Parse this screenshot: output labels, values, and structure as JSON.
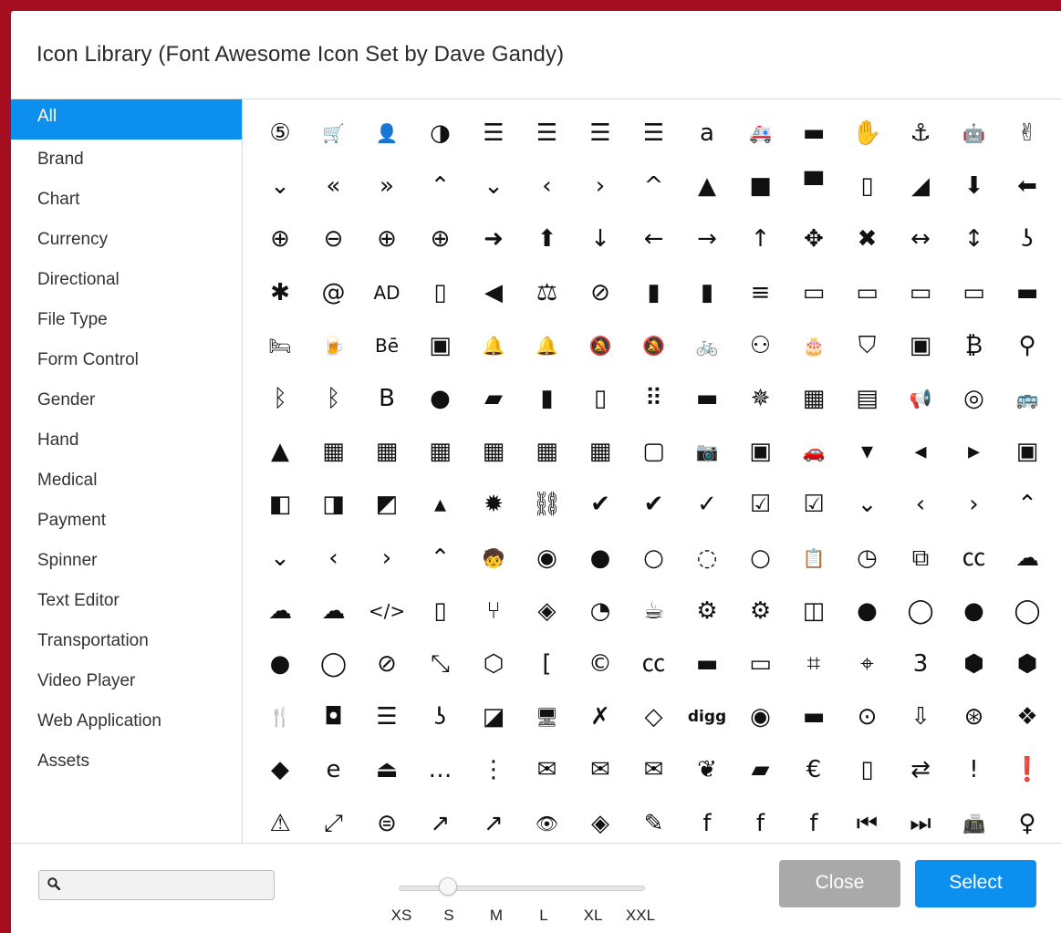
{
  "dialog": {
    "title": "Icon Library (Font Awesome Icon Set by Dave Gandy)"
  },
  "categories": [
    {
      "label": "All",
      "active": true
    },
    {
      "label": "Brand"
    },
    {
      "label": "Chart"
    },
    {
      "label": "Currency"
    },
    {
      "label": "Directional"
    },
    {
      "label": "File Type"
    },
    {
      "label": "Form Control"
    },
    {
      "label": "Gender"
    },
    {
      "label": "Hand"
    },
    {
      "label": "Medical"
    },
    {
      "label": "Payment"
    },
    {
      "label": "Spinner"
    },
    {
      "label": "Text Editor"
    },
    {
      "label": "Transportation"
    },
    {
      "label": "Video Player"
    },
    {
      "label": "Web Application"
    },
    {
      "label": "Assets"
    }
  ],
  "icons": [
    [
      "html5",
      "cart-arrow-down",
      "user-plus",
      "adjust",
      "align-center",
      "align-justify",
      "align-left",
      "align-right",
      "amazon",
      "ambulance",
      "amex",
      "asl-interpreting",
      "anchor",
      "android",
      "hand-peace"
    ],
    [
      "angle-double-down",
      "angle-double-left",
      "angle-double-right",
      "angle-double-up",
      "angle-down",
      "angle-left",
      "angle-right",
      "angle-up",
      "angellist",
      "apple",
      "archive",
      "file-zip",
      "area-chart",
      "arrow-circle-down",
      "arrow-circle-left"
    ],
    [
      "arrow-circle-o-down",
      "arrow-circle-o-left",
      "arrow-circle-o-right",
      "arrow-circle-o-up",
      "arrow-circle-right",
      "arrow-circle-up",
      "arrow-down",
      "arrow-left",
      "arrow-right",
      "arrow-up",
      "arrows",
      "arrows-alt",
      "arrows-h",
      "arrows-v",
      "assistive-listening"
    ],
    [
      "asterisk",
      "at",
      "audio-description",
      "file-audio",
      "backward",
      "balance-scale",
      "ban",
      "bar-chart",
      "barcode",
      "bars",
      "battery-3",
      "battery-1",
      "battery-2",
      "battery-empty",
      "battery-full"
    ],
    [
      "bed",
      "beer",
      "behance",
      "behance-square",
      "bell",
      "bell-o",
      "bell-slash",
      "bell-slash-o",
      "bicycle",
      "binoculars",
      "birthday-cake",
      "bitbucket",
      "bitbucket-square",
      "bitcoin",
      "blind"
    ],
    [
      "bluetooth",
      "bluetooth-b",
      "bold",
      "bomb",
      "book",
      "bookmark",
      "bookmark-o",
      "braille",
      "briefcase",
      "bug",
      "building",
      "building-o",
      "bullhorn",
      "bullseye",
      "bus"
    ],
    [
      "buysellads",
      "calculator",
      "calendar",
      "calendar-check",
      "calendar-minus",
      "calendar-plus",
      "calendar-times",
      "calendar-o",
      "camera",
      "camera-retro",
      "car",
      "caret-down",
      "caret-left",
      "caret-right",
      "caret-square-down"
    ],
    [
      "caret-square-left",
      "caret-square-right",
      "caret-square-up",
      "caret-up",
      "certificate",
      "chain-broken",
      "check",
      "check-circle",
      "check-circle-o",
      "check-square",
      "check-square-o",
      "chevron-circle-down",
      "chevron-circle-left",
      "chevron-circle-right",
      "chevron-circle-up"
    ],
    [
      "chevron-down",
      "chevron-left",
      "chevron-right",
      "chevron-up",
      "child",
      "chrome",
      "circle",
      "circle-o",
      "circle-o-notch",
      "circle-thin",
      "clipboard",
      "clock",
      "clone",
      "closed-captioning",
      "cloud"
    ],
    [
      "cloud-download",
      "cloud-upload",
      "code",
      "file-code",
      "code-fork",
      "codepen",
      "codiepie",
      "coffee",
      "cog",
      "cogs",
      "columns",
      "comment",
      "comment-o",
      "commenting",
      "commenting-o"
    ],
    [
      "comments",
      "comments-o",
      "compass",
      "compress",
      "connectdevelop",
      "contao",
      "copyright",
      "creative-commons",
      "credit-card",
      "credit-card-alt",
      "crop",
      "crosshairs",
      "css3",
      "cube",
      "cubes"
    ],
    [
      "cutlery",
      "dashcube",
      "database",
      "deaf",
      "delicious",
      "desktop",
      "deviantart",
      "diamond",
      "digg",
      "cc-diners-club",
      "cc-discover",
      "dot-circle",
      "download",
      "dribbble",
      "dropbox"
    ],
    [
      "drupal",
      "edge",
      "eject",
      "ellipsis-h",
      "ellipsis-v",
      "envelope",
      "envelope-o",
      "envelope-square",
      "envira",
      "eraser",
      "euro",
      "file-excel",
      "exchange",
      "exclamation",
      "exclamation-circle"
    ],
    [
      "exclamation-triangle",
      "expand",
      "expeditedssl",
      "external-link",
      "external-link-square",
      "eye",
      "eye-slash",
      "eyedropper",
      "facebook",
      "facebook-square",
      "facebook-official",
      "fast-backward",
      "fast-forward",
      "fax",
      "female"
    ]
  ],
  "search": {
    "value": "",
    "placeholder": ""
  },
  "size_slider": {
    "labels": [
      "XS",
      "S",
      "M",
      "L",
      "XL",
      "XXL"
    ],
    "selected": "S"
  },
  "buttons": {
    "close_label": "Close",
    "select_label": "Select"
  },
  "colors": {
    "accent": "#0d8ff0",
    "close": "#a9a9a9",
    "frame": "#a50e1f"
  }
}
